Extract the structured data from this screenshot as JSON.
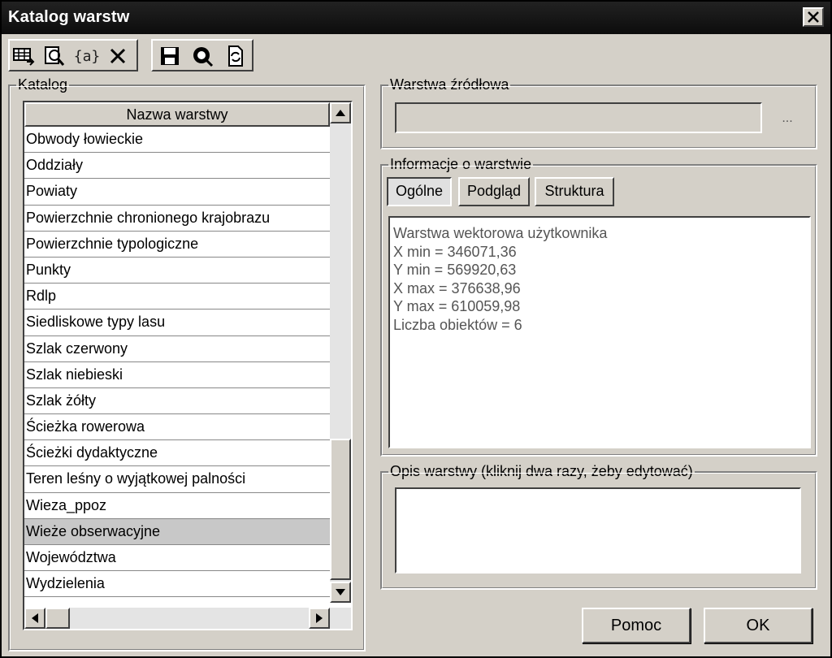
{
  "window": {
    "title": "Katalog warstw"
  },
  "toolbar": {
    "buttons": [
      {
        "icon": "add-layer-icon"
      },
      {
        "icon": "zoom-layer-icon"
      },
      {
        "icon": "attributes-icon",
        "label": "{a}"
      },
      {
        "icon": "delete-icon"
      },
      {
        "icon": "save-icon"
      },
      {
        "icon": "preview-icon"
      },
      {
        "icon": "refresh-icon"
      }
    ]
  },
  "catalog": {
    "label": "Katalog",
    "column_header": "Nazwa warstwy",
    "rows": [
      "Obwody łowieckie",
      "Oddziały",
      "Powiaty",
      "Powierzchnie chronionego krajobrazu",
      "Powierzchnie typologiczne",
      "Punkty",
      "Rdlp",
      "Siedliskowe typy lasu",
      "Szlak czerwony",
      "Szlak niebieski",
      "Szlak żółty",
      "Ścieżka rowerowa",
      "Ścieżki dydaktyczne",
      "Teren leśny o wyjątkowej palności",
      "Wieza_ppoz",
      "Wieże obserwacyjne",
      "Województwa",
      "Wydzielenia"
    ],
    "selected_row": "Wieże obserwacyjne"
  },
  "source": {
    "label": "Warstwa źródłowa",
    "value": "",
    "browse_label": "..."
  },
  "info": {
    "label": "Informacje o warstwie",
    "tabs": [
      "Ogólne",
      "Podgląd",
      "Struktura"
    ],
    "active_tab": "Ogólne",
    "lines": [
      "Warstwa wektorowa użytkownika",
      "X min = 346071,36",
      "Y min = 569920,63",
      "X max = 376638,96",
      "Y max = 610059,98",
      "Liczba obiektów = 6"
    ]
  },
  "description": {
    "label": "Opis warstwy (kliknij dwa razy, żeby edytować)",
    "value": ""
  },
  "buttons": {
    "help": "Pomoc",
    "ok": "OK"
  },
  "colors": {
    "face": "#d4d0c8",
    "titlebar": "#111111",
    "selection": "#c8c8c8"
  }
}
